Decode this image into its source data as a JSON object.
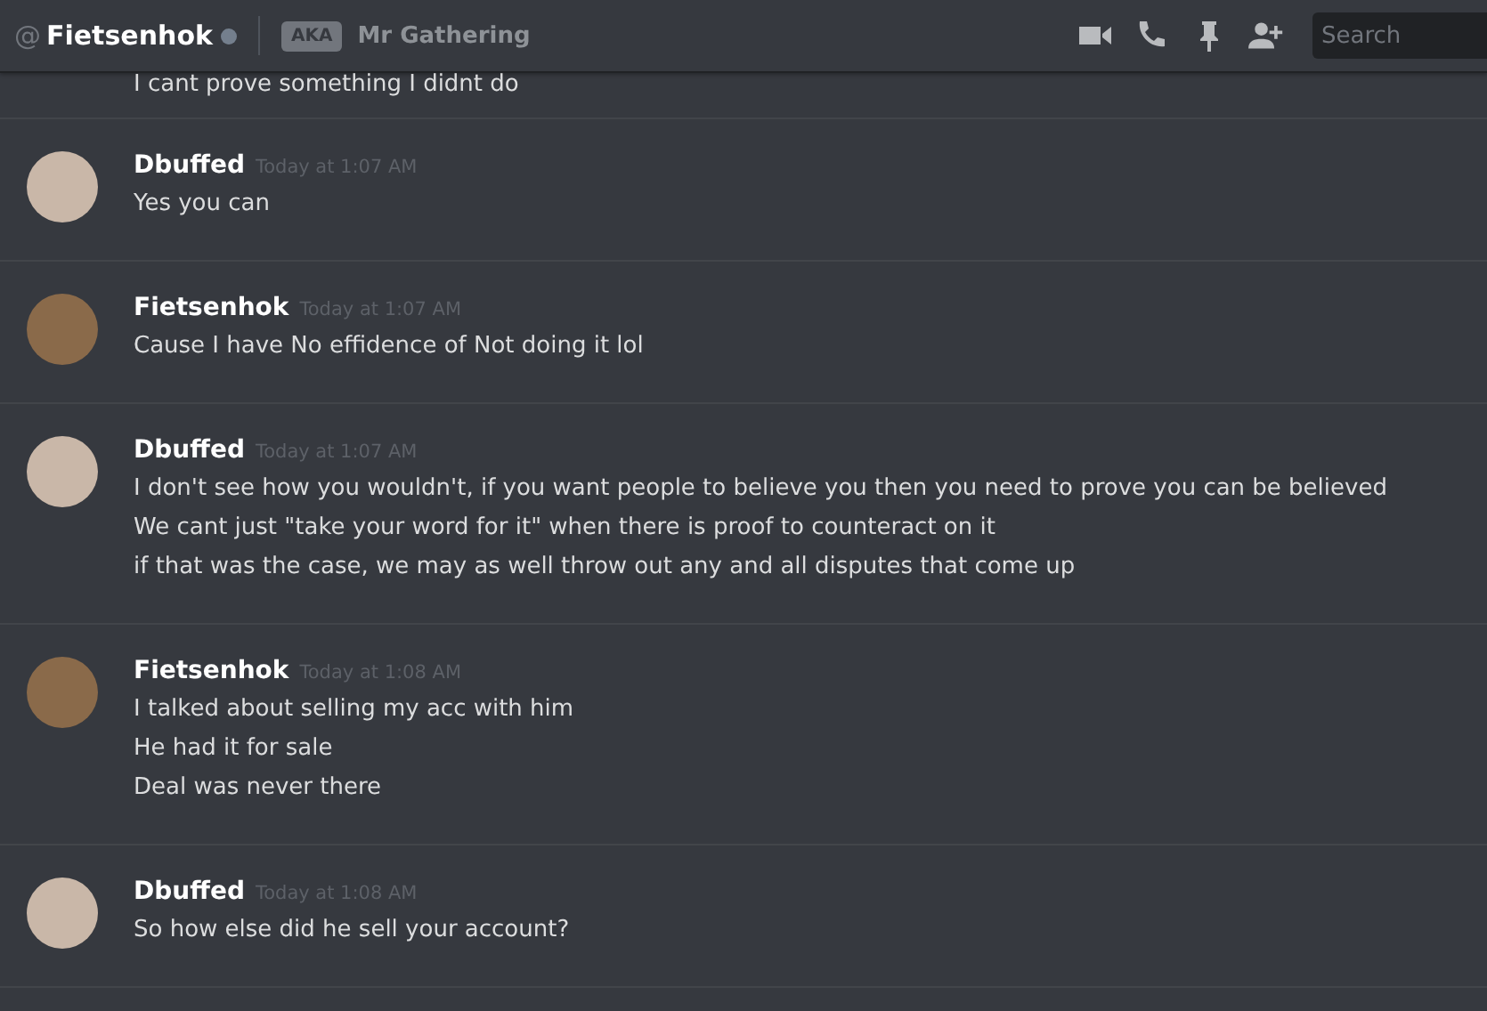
{
  "header": {
    "at": "@",
    "username": "Fietsenhok",
    "status_dot": {
      "color": "#747f8d"
    },
    "aka_badge": "AKA",
    "nickname": "Mr Gathering",
    "search": {
      "placeholder": "Search"
    }
  },
  "partial_message": "I cant prove something I didnt do",
  "messages": [
    {
      "author": "Dbuffed",
      "color": "#c9b7a8",
      "timestamp": "Today at 1:07 AM",
      "lines": [
        "Yes you can"
      ]
    },
    {
      "author": "Fietsenhok",
      "color": "#8a6a4a",
      "timestamp": "Today at 1:07 AM",
      "lines": [
        "Cause I have No effidence of Not doing it lol"
      ]
    },
    {
      "author": "Dbuffed",
      "color": "#c9b7a8",
      "timestamp": "Today at 1:07 AM",
      "lines": [
        "I don't see how you wouldn't, if you want people to believe you then you need to prove you can be believed",
        "We cant just \"take your word for it\" when there is proof to counteract on it",
        "if that was the case, we may as well throw out any and all disputes that come up"
      ]
    },
    {
      "author": "Fietsenhok",
      "color": "#8a6a4a",
      "timestamp": "Today at 1:08 AM",
      "lines": [
        "I talked about selling my acc with him",
        "He had it for sale",
        "Deal was never there"
      ]
    },
    {
      "author": "Dbuffed",
      "color": "#c9b7a8",
      "timestamp": "Today at 1:08 AM",
      "lines": [
        "So how else did he sell your account?"
      ]
    }
  ]
}
